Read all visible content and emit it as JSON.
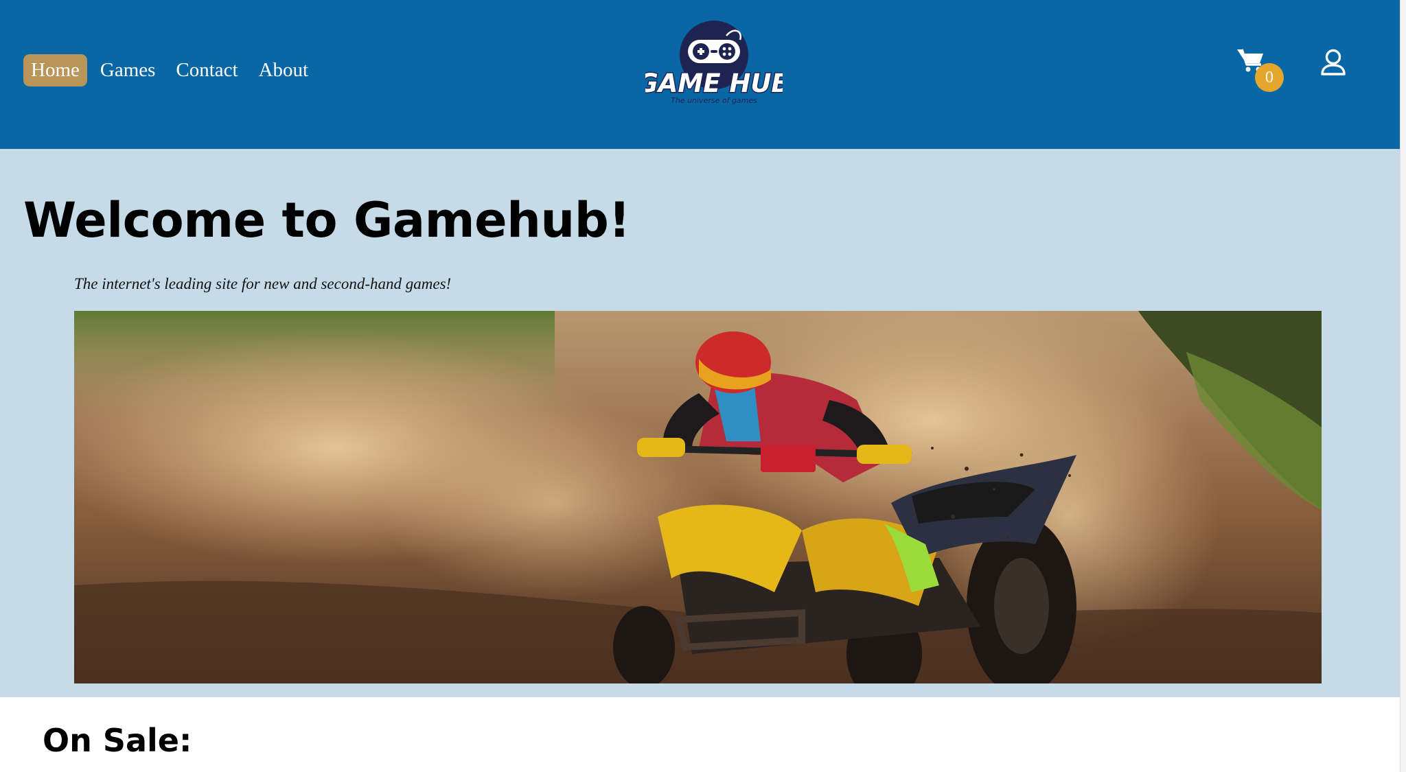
{
  "nav": {
    "items": [
      {
        "label": "Home",
        "active": true
      },
      {
        "label": "Games",
        "active": false
      },
      {
        "label": "Contact",
        "active": false
      },
      {
        "label": "About",
        "active": false
      }
    ]
  },
  "logo": {
    "title": "GAME HUB",
    "tagline": "The universe of games"
  },
  "cart": {
    "count": "0",
    "icon": "cart-icon"
  },
  "user": {
    "icon": "user-icon"
  },
  "hero": {
    "title": "Welcome to Gamehub!",
    "subtitle": "The internet's leading site for new and second-hand games!",
    "image": "atv-rider-dirt-track-photo"
  },
  "sale": {
    "title": "On Sale:"
  },
  "colors": {
    "header_bg": "#0a67a6",
    "hero_bg": "#c5dbe8",
    "active_nav_bg": "#b9955a",
    "badge_bg": "#e4a72b",
    "logo_dark": "#1d2452"
  }
}
